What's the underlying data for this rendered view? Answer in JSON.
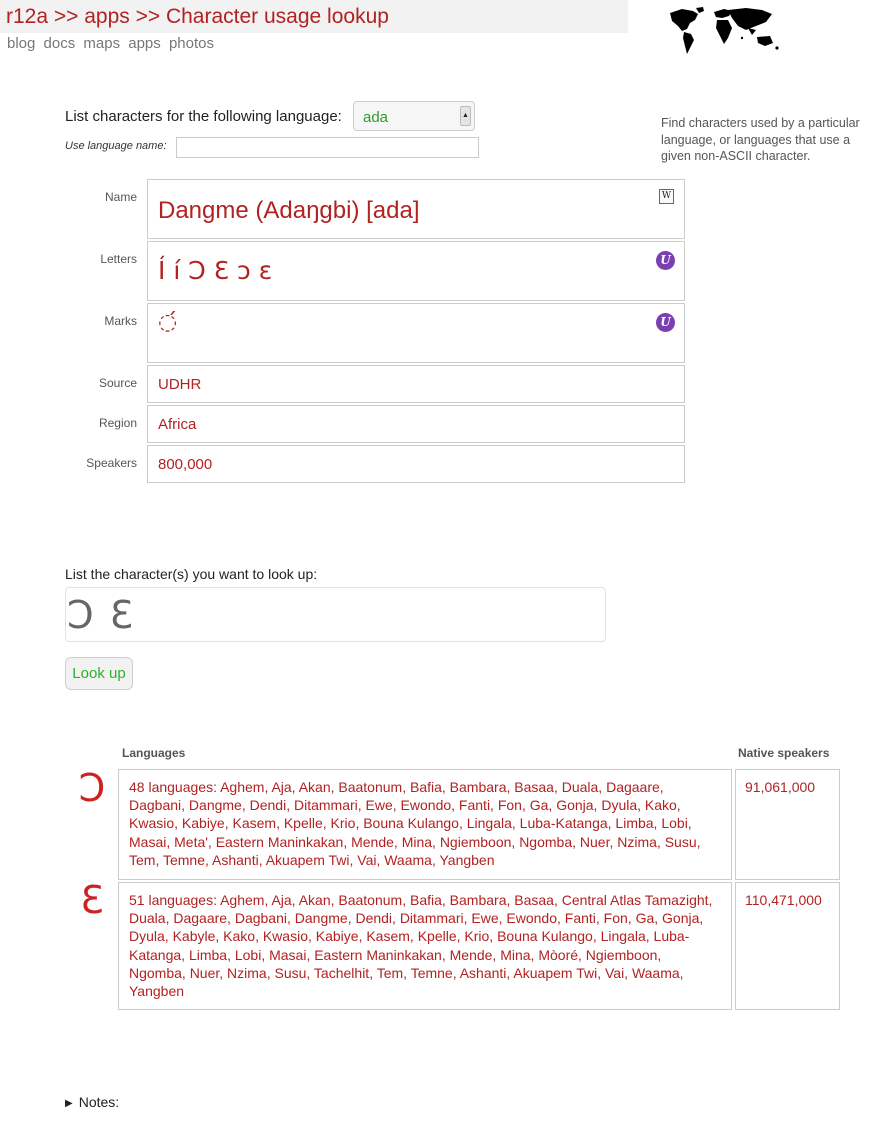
{
  "header": {
    "title": "r12a >> apps >> Character usage lookup",
    "nav": [
      "blog",
      "docs",
      "maps",
      "apps",
      "photos"
    ]
  },
  "language_picker": {
    "prompt": "List characters for the following language:",
    "selected": "ada",
    "name_label": "Use language name:",
    "name_value": ""
  },
  "intro": "Find characters used by a particular language, or languages that use a given non-ASCII character.",
  "details": {
    "name_label": "Name",
    "name": "Dangme (Adaŋgbi) [ada]",
    "letters_label": "Letters",
    "letters": "Í í Ɔ Ɛ ɔ ɛ",
    "marks_label": "Marks",
    "marks": "◌́",
    "source_label": "Source",
    "source": "UDHR",
    "region_label": "Region",
    "region": "Africa",
    "speakers_label": "Speakers",
    "speakers": "800,000"
  },
  "lookup": {
    "prompt": "List the character(s) you want to look up:",
    "value": "Ɔ Ɛ",
    "button": "Look up"
  },
  "results": {
    "col_languages": "Languages",
    "col_speakers": "Native speakers",
    "rows": [
      {
        "char": "Ɔ",
        "languages": "48 languages: Aghem, Aja, Akan, Baatonum, Bafia, Bambara, Basaa, Duala, Dagaare, Dagbani, Dangme, Dendi, Ditammari, Ewe, Ewondo, Fanti, Fon, Ga, Gonja, Dyula, Kako, Kwasio, Kabiye, Kasem, Kpelle, Krio, Bouna Kulango, Lingala, Luba-Katanga, Limba, Lobi, Masai, Meta', Eastern Maninkakan, Mende, Mina, Ngiemboon, Ngomba, Nuer, Nzima, Susu, Tem, Temne, Ashanti, Akuapem Twi, Vai, Waama, Yangben",
        "speakers": "91,061,000"
      },
      {
        "char": "Ɛ",
        "languages": "51 languages: Aghem, Aja, Akan, Baatonum, Bafia, Bambara, Basaa, Central Atlas Tamazight, Duala, Dagaare, Dagbani, Dangme, Dendi, Ditammari, Ewe, Ewondo, Fanti, Fon, Ga, Gonja, Dyula, Kabyle, Kako, Kwasio, Kabiye, Kasem, Kpelle, Krio, Bouna Kulango, Lingala, Luba-Katanga, Limba, Lobi, Masai, Eastern Maninkakan, Mende, Mina, Mòoré, Ngiemboon, Ngomba, Nuer, Nzima, Susu, Tachelhit, Tem, Temne, Ashanti, Akuapem Twi, Vai, Waama, Yangben",
        "speakers": "110,471,000"
      }
    ]
  },
  "notes": "Notes:"
}
